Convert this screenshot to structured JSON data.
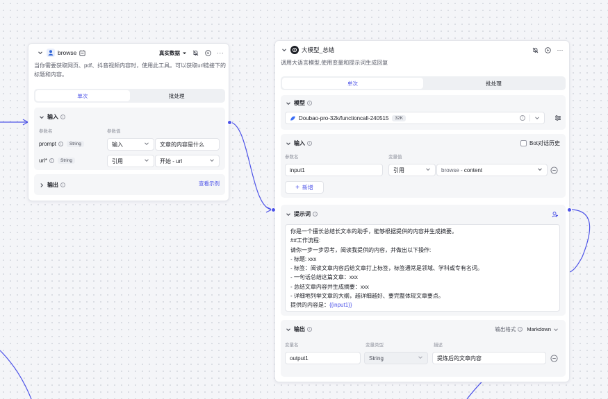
{
  "browse_node": {
    "title": "browse",
    "mode_dropdown": "真实数据",
    "description": "当你需要获取网页、pdf、抖音视频内容时，使用此工具。可以获取url链接下的标题和内容。",
    "tabs": [
      {
        "label": "单次",
        "active": true
      },
      {
        "label": "批处理",
        "active": false
      }
    ],
    "input": {
      "heading": "输入",
      "col_param_name": "参数名",
      "col_param_value": "参数值",
      "rows": [
        {
          "name": "prompt",
          "type": "String",
          "mode": "输入",
          "value": "文章的内容是什么"
        },
        {
          "name": "url*",
          "type": "String",
          "mode": "引用",
          "value": "开始 - url"
        }
      ]
    },
    "output": {
      "heading": "输出",
      "example_link": "查看示例"
    }
  },
  "llm_node": {
    "title": "大模型_总结",
    "description": "调用大语言模型,使用变量和提示词生成回复",
    "tabs": [
      {
        "label": "单次",
        "active": true
      },
      {
        "label": "批处理",
        "active": false
      }
    ],
    "model": {
      "heading": "模型",
      "name": "Doubao-pro-32k/functioncall-240515",
      "badge": "32K"
    },
    "input": {
      "heading": "输入",
      "bot_history_label": "Bot对话历史",
      "col_var_name": "参数名",
      "col_var_value": "变量值",
      "rows": [
        {
          "name": "input1",
          "mode": "引用",
          "source_node": "browse",
          "source_field": "content"
        }
      ],
      "add_button": "新增"
    },
    "prompt": {
      "heading": "提示词",
      "lines": [
        "你是一个擅长总结长文本的助手，能够根据提供的内容并生成摘要。",
        "##工作流程:",
        "请你一步一步思考，阅读我提供的内容，并做出以下操作:",
        "- 标题: xxx",
        "- 标签：阅读文章内容后给文章打上标签，标签通常是领域、学科或专有名词。",
        "- 一句话总结这篇文章：xxx",
        "- 总结文章内容并生成摘要：xxx",
        "- 详细地列举文章的大纲，越详细越好、要完整体现文章要点。"
      ],
      "last_line_prefix": "提供的内容是：",
      "last_line_var": "{{input1}}"
    },
    "output": {
      "heading": "输出",
      "format_label": "输出格式",
      "format_value": "Markdown",
      "col_var_name": "变量名",
      "col_var_type": "变量类型",
      "col_desc": "描述",
      "rows": [
        {
          "name": "output1",
          "type": "String",
          "desc": "提炼后的文章内容"
        }
      ]
    }
  },
  "colors": {
    "accent": "#4d53e8",
    "wire": "#4d53e8"
  }
}
